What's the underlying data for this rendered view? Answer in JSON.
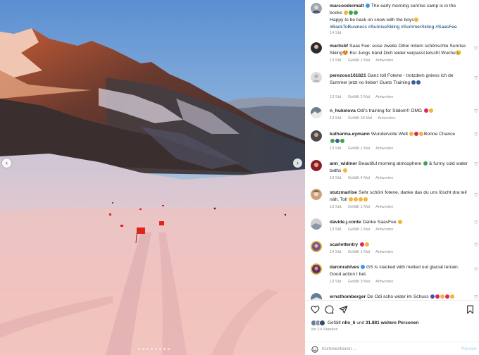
{
  "post": {
    "author": "marcoodermatt",
    "caption_line1": "The early morning sunrise camp is in the books",
    "caption_line2": "Happy to be back on snow with the boys",
    "hashtags": "#BackToBusiness #SunriseSkiing #SummerSkiing #SaasFee",
    "time": "14 Std."
  },
  "comments": [
    {
      "user": "marlisbf",
      "text": "Saas Fee: euse zweite Dihei mitem schönschte Sunrise Skiing😍 Eui Jungs händ Dich leider verpasst letscht Wuche😢",
      "time": "13 Std.",
      "likes": "Gefällt 1 Mal",
      "reply": "Antworten",
      "avatar_color": "#2b2b2b"
    },
    {
      "user": "perezoso161821",
      "text": "Ganz toll Fotene - trotzdem gniess ich de Summer jetzt no lieber! Guets Training",
      "time": "13 Std.",
      "likes": "Gefällt 2 Mal",
      "reply": "Antworten",
      "avatar_color": "#d9d9d9"
    },
    {
      "user": "n_hukelova",
      "text": "Odi's training for Slalom!! OMG",
      "time": "13 Std.",
      "likes": "Gefällt 18 Mal",
      "reply": "Antworten",
      "avatar_color": "#6b7f8e"
    },
    {
      "user": "katharina.eymann",
      "text": "Wundervolle Welt",
      "text2": "Bonne Chance",
      "time": "13 Std.",
      "likes": "Gefällt 1 Mal",
      "reply": "Antworten",
      "avatar_color": "#4a4a4a"
    },
    {
      "user": "ann_widmer",
      "text": "Beautiful morning atmosphere",
      "text2": "& funny cold water baths",
      "time": "13 Std.",
      "likes": "Gefällt 4 Mal",
      "reply": "Antworten",
      "avatar_color": "#8b1a2b"
    },
    {
      "user": "stutzmarlise",
      "text": "Sehr schöni fotene, danke das du uns löscht dra teil näh. Toll",
      "time": "13 Std.",
      "likes": "Gefällt 1 Mal",
      "reply": "Antworten",
      "avatar_color": "#c9a27a"
    },
    {
      "user": "davide.j.conte",
      "text": "Danke SaasFee",
      "time": "13 Std.",
      "likes": "Gefällt 1 Mal",
      "reply": "Antworten",
      "avatar_color": "#cfcfcf"
    },
    {
      "user": "scarlettentry",
      "text": "",
      "time": "14 Std.",
      "likes": "Gefällt 1 Mal",
      "reply": "Antworten",
      "avatar_color": "#7a4e8c"
    },
    {
      "user": "daronrahlves",
      "text": "GS is stacked with melted out glacial terrain. Good action I bet.",
      "time": "13 Std.",
      "likes": "Gefällt 3 Mal",
      "reply": "Antworten",
      "avatar_color": "#5e2a6e"
    },
    {
      "user": "ernsthomberger",
      "text": "De Odi scho wider im Schuss",
      "time": "",
      "likes": "",
      "reply": "",
      "avatar_color": "#5f7f9a"
    }
  ],
  "likes_summary": {
    "prefix": "Gefällt",
    "user": "nllo_6",
    "middle": "und",
    "count": "31.881 weitere Personen"
  },
  "time_ago": "Vor 14 Stunden",
  "comment_input": {
    "placeholder": "Kommentieren ...",
    "post_label": "Posten"
  },
  "icons": {
    "like": "heart-icon",
    "comment": "speech-bubble-icon",
    "share": "paper-plane-icon",
    "save": "bookmark-icon",
    "emoji": "smiley-icon"
  },
  "colors": {
    "link": "#00376b",
    "muted": "#8e8e8e",
    "post_button": "#b2dffc",
    "heart": "#ed4956"
  }
}
